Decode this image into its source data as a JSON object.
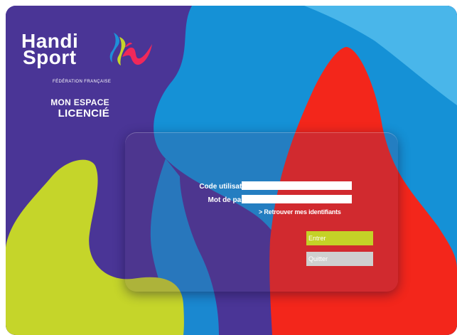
{
  "branding": {
    "logo_line1": "Handi",
    "logo_line2": "Sport",
    "logo_subtitle": "FÉDÉRATION FRANÇAISE",
    "section_title_line1": "MON ESPACE",
    "section_title_line2": "LICENCIÉ"
  },
  "login_form": {
    "username_label": "Code utilisateur :",
    "username_value": "",
    "password_label": "Mot de passe :",
    "password_value": "",
    "recover_link": "> Retrouver mes identifiants",
    "enter_button": "Entrer",
    "quit_button": "Quitter"
  },
  "colors": {
    "background_purple": "#4a3596",
    "shape_blue": "#1591d6",
    "shape_red": "#f3261b",
    "shape_lime": "#c5d52a",
    "enter_button": "#c4d227",
    "quit_button": "#cfcfcf"
  },
  "icons": {
    "logo_mark": "handisport-flame-icon"
  }
}
